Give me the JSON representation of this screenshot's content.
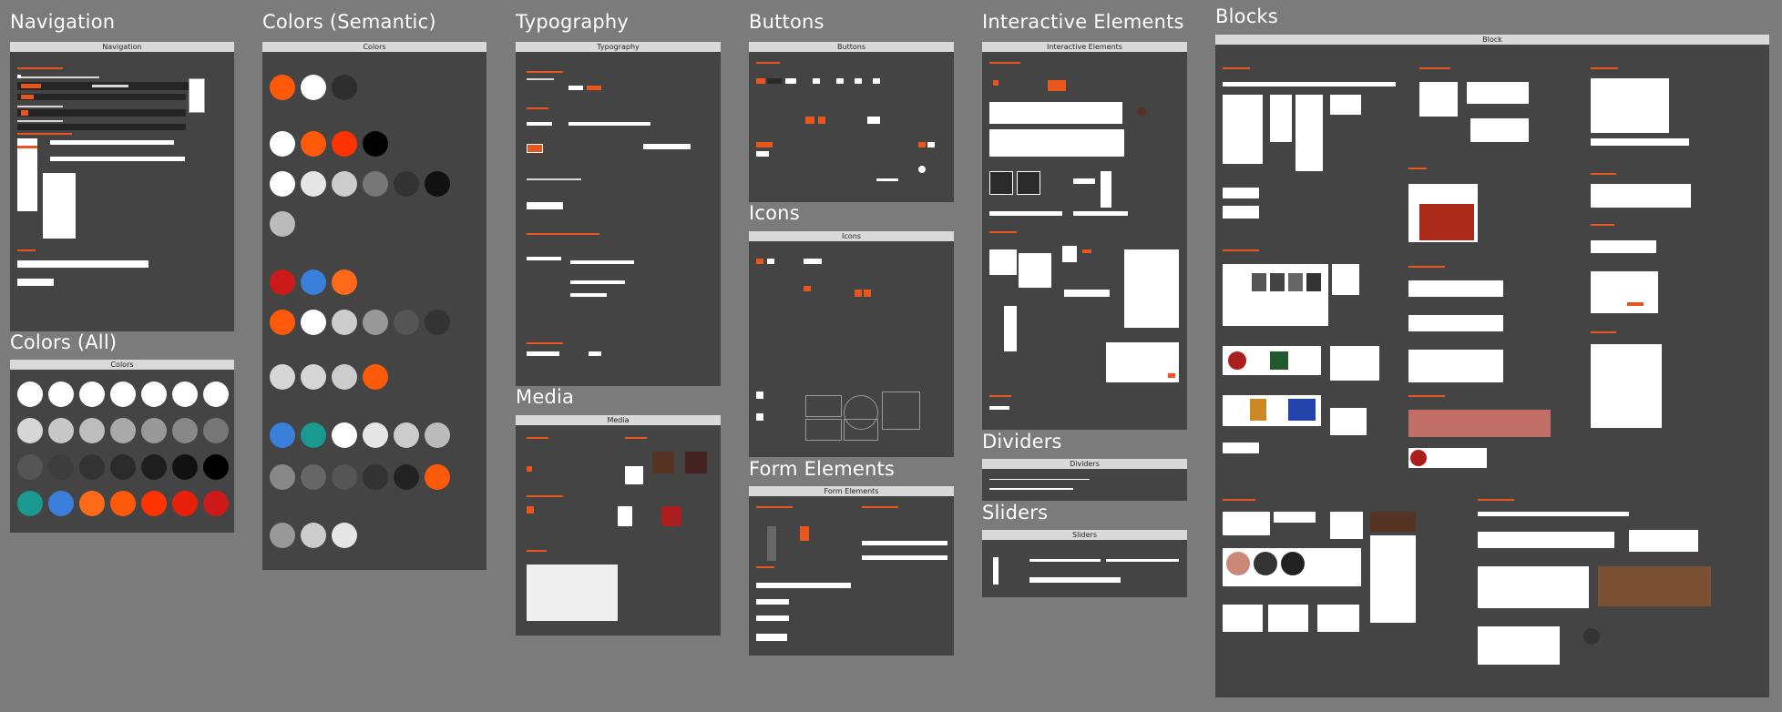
{
  "sections": {
    "navigation": "Navigation",
    "colors_semantic": "Colors (Semantic)",
    "typography": "Typography",
    "buttons": "Buttons",
    "interactive": "Interactive Elements",
    "blocks": "Blocks",
    "colors_all": "Colors (All)",
    "icons": "Icons",
    "media": "Media",
    "form_elements": "Form Elements",
    "dividers": "Dividers",
    "sliders": "Sliders"
  },
  "frames": {
    "navigation": "Navigation",
    "colors_semantic": "Colors",
    "typography": "Typography",
    "buttons": "Buttons",
    "interactive": "Interactive Elements",
    "blocks": "Block",
    "colors_all": "Colors",
    "icons": "Icons",
    "media": "Media",
    "form_elements": "Form Elements",
    "dividers": "Dividers",
    "sliders": "Sliders"
  },
  "colors": {
    "canvas": "#7b7b7b",
    "frame": "#444444",
    "frame_header": "#d9d9d9",
    "accent": "#e8561e",
    "blue": "#3a7fd9",
    "teal": "#1a9990",
    "red": "#cc1a1a",
    "white": "#ffffff"
  },
  "color_swatches_all": [
    [
      "#ffffff",
      "#ffffff",
      "#ffffff",
      "#ffffff",
      "#ffffff",
      "#ffffff",
      "#ffffff"
    ],
    [
      "#d6d6d6",
      "#c8c8c8",
      "#bdbdbd",
      "#aaaaaa",
      "#999999",
      "#888888",
      "#777777"
    ],
    [
      "#555555",
      "#3d3d3d",
      "#333333",
      "#2a2a2a",
      "#1e1e1e",
      "#111111",
      "#000000"
    ],
    [
      "#1a9990",
      "#3a7fd9",
      "#ff6a1a",
      "#ff5a0a",
      "#ff3300",
      "#e8200a",
      "#cc1a1a"
    ]
  ],
  "color_swatches_semantic": {
    "row1": [
      "#ff5a0a",
      "#ffffff",
      "#2e2e2e"
    ],
    "row2": [
      "#ffffff",
      "#ff5a0a",
      "#ff3300",
      "#000000"
    ],
    "row3": [
      "#ffffff",
      "#e6e6e6",
      "#cccccc",
      "#777777",
      "#333333",
      "#111111"
    ],
    "row4": [
      "#bbbbbb"
    ],
    "row5": [
      "#cc1a1a",
      "#3a7fd9",
      "#ff6a1a"
    ],
    "row6": [
      "#ff5a0a",
      "#ffffff",
      "#cccccc",
      "#999999",
      "#555555",
      "#333333"
    ],
    "row7": [
      "#d6d6d6",
      "#d6d6d6",
      "#cccccc",
      "#ff5a0a"
    ],
    "row8": [
      "#3a7fd9",
      "#1a9990",
      "#ffffff",
      "#e6e6e6",
      "#cccccc",
      "#bbbbbb"
    ],
    "row9": [
      "#888888",
      "#666666",
      "#555555",
      "#333333",
      "#222222",
      "#ff5a0a"
    ],
    "row10": [
      "#999999",
      "#cccccc",
      "#e6e6e6"
    ]
  }
}
